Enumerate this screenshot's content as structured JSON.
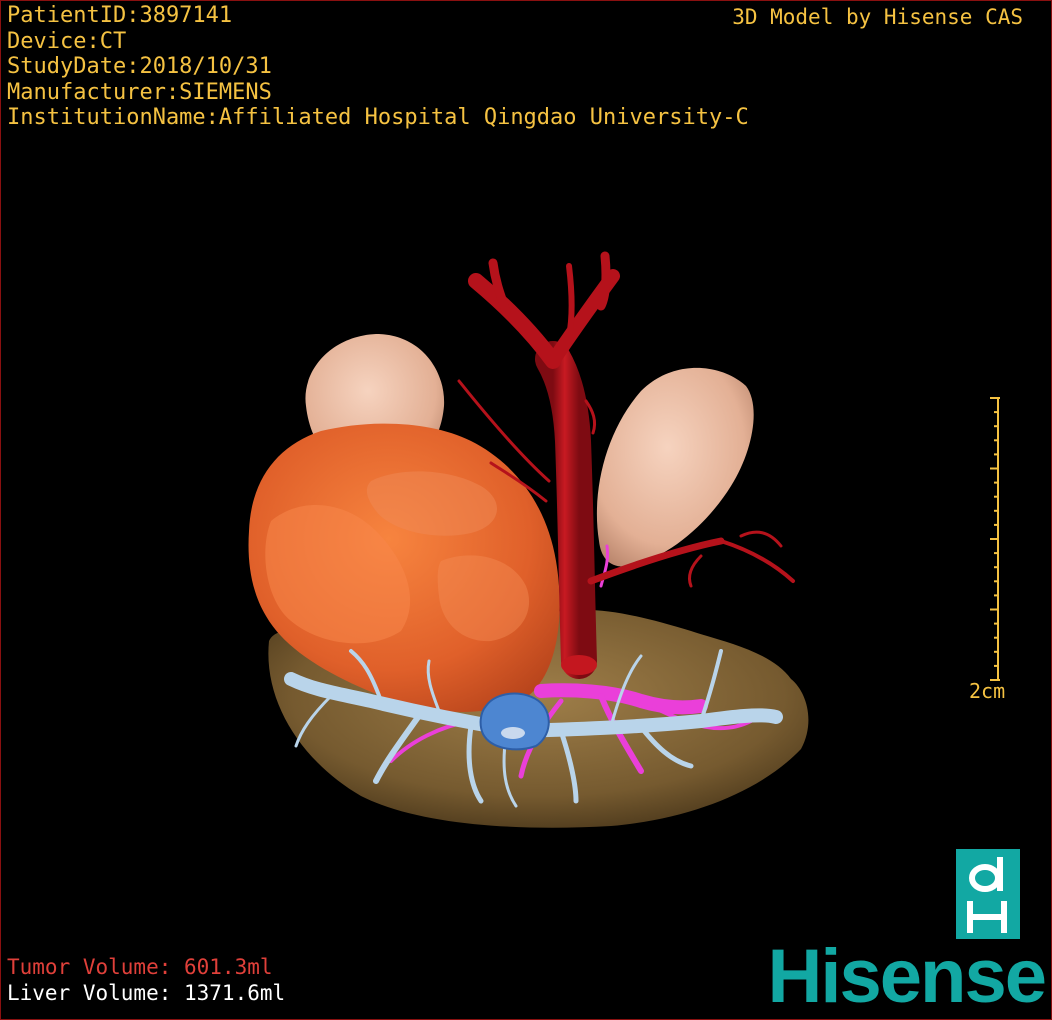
{
  "info": {
    "patient_id": "PatientID:3897141",
    "device": "Device:CT",
    "study_date": "StudyDate:2018/10/31",
    "manufacturer": "Manufacturer:SIEMENS",
    "institution": "InstitutionName:Affiliated Hospital Qingdao University-C"
  },
  "credit": "3D Model by Hisense CAS",
  "volumes": {
    "tumor": "Tumor Volume:  601.3ml",
    "liver": "Liver Volume: 1371.6ml"
  },
  "scale": {
    "label": "2cm"
  },
  "brand": {
    "wordmark": "Hisense",
    "mark_letters": "dH"
  },
  "colors": {
    "overlay_text": "#f5c242",
    "tumor_text": "#e0403a",
    "liver_text": "#ffffff",
    "brand_teal": "#12a8a3",
    "liver": "#8a6a3a",
    "tumor": "#e8642f",
    "kidney": "#e7b9a0",
    "artery": "#b5121b",
    "portal_vein": "#b9d4ea",
    "hepatic_vein": "#ea3fd9",
    "biliary": "#4d86d1",
    "border": "#8a1010"
  }
}
